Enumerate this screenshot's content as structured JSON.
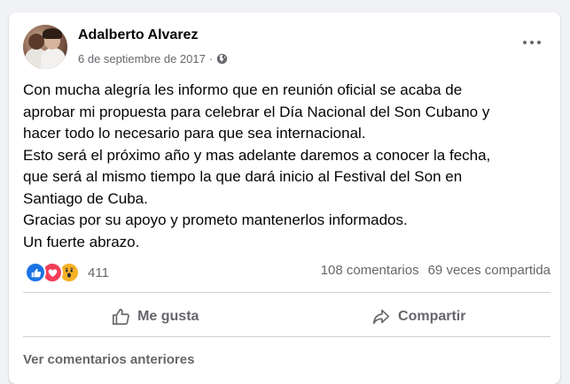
{
  "post": {
    "author": "Adalberto Alvarez",
    "date": "6 de septiembre de 2017",
    "separator": "·",
    "privacy_icon": "globe-icon",
    "more_icon": "more-horizontal-icon",
    "text_lines": [
      "Con mucha alegría les informo que en reunión oficial se acaba de",
      "aprobar mi propuesta para celebrar el Día Nacional del Son Cubano y",
      "hacer todo lo necesario para que sea internacional.",
      "Esto será el próximo año y mas adelante daremos a conocer la fecha,",
      "que será al mismo tiempo la que dará inicio al Festival del Son en",
      "Santiago de Cuba.",
      "Gracias por su apoyo y prometo mantenerlos informados.",
      "Un fuerte abrazo."
    ]
  },
  "reactions": {
    "icons": [
      "like-icon",
      "love-icon",
      "wow-icon"
    ],
    "count": "411"
  },
  "stats": {
    "comments": "108 comentarios",
    "shares": "69 veces compartida"
  },
  "actions": {
    "like_label": "Me gusta",
    "share_label": "Compartir"
  },
  "comments": {
    "view_previous": "Ver comentarios anteriores"
  },
  "colors": {
    "like_blue": "#1b74e4",
    "love_red": "#f33e58",
    "wow_yellow": "#f7b125",
    "secondary_text": "#65676b",
    "background": "#f0f2f5"
  }
}
